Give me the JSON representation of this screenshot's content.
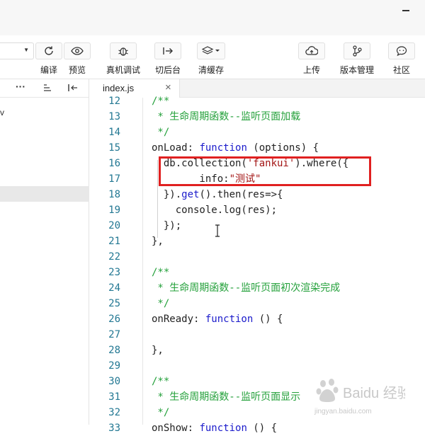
{
  "toolbar": {
    "compile_label": "编译",
    "preview_label": "预览",
    "remote_debug_label": "真机调试",
    "background_label": "切后台",
    "clear_cache_label": "清缓存",
    "upload_label": "上传",
    "version_label": "版本管理",
    "community_label": "社区"
  },
  "sidebar": {
    "tree_partial_text": "v"
  },
  "tabs": [
    {
      "title": "index.js",
      "close": "×"
    }
  ],
  "editor": {
    "lines": [
      {
        "n": "12",
        "tokens": [
          {
            "t": "/**",
            "c": "comment"
          }
        ]
      },
      {
        "n": "13",
        "tokens": [
          {
            "t": " * 生命周期函数--监听页面加载",
            "c": "comment"
          }
        ]
      },
      {
        "n": "14",
        "tokens": [
          {
            "t": " */",
            "c": "comment"
          }
        ]
      },
      {
        "n": "15",
        "tokens": [
          {
            "t": "onLoad: ",
            "c": "txt"
          },
          {
            "t": "function",
            "c": "kw"
          },
          {
            "t": " (options) {",
            "c": "txt"
          }
        ]
      },
      {
        "n": "16",
        "tokens": [
          {
            "t": "  db.collection(",
            "c": "txt"
          },
          {
            "t": "'fankui'",
            "c": "str"
          },
          {
            "t": ").where({",
            "c": "txt"
          }
        ]
      },
      {
        "n": "17",
        "tokens": [
          {
            "t": "        info:",
            "c": "txt"
          },
          {
            "t": "\"测试\"",
            "c": "str"
          }
        ]
      },
      {
        "n": "18",
        "tokens": [
          {
            "t": "  }).",
            "c": "txt"
          },
          {
            "t": "get",
            "c": "kw"
          },
          {
            "t": "().then(res=>{",
            "c": "txt"
          }
        ]
      },
      {
        "n": "19",
        "tokens": [
          {
            "t": "    console.log(res);",
            "c": "txt"
          }
        ]
      },
      {
        "n": "20",
        "tokens": [
          {
            "t": "  });",
            "c": "txt"
          }
        ]
      },
      {
        "n": "21",
        "tokens": [
          {
            "t": "},",
            "c": "txt"
          }
        ]
      },
      {
        "n": "22",
        "tokens": []
      },
      {
        "n": "23",
        "tokens": [
          {
            "t": "/**",
            "c": "comment"
          }
        ]
      },
      {
        "n": "24",
        "tokens": [
          {
            "t": " * 生命周期函数--监听页面初次渲染完成",
            "c": "comment"
          }
        ]
      },
      {
        "n": "25",
        "tokens": [
          {
            "t": " */",
            "c": "comment"
          }
        ]
      },
      {
        "n": "26",
        "tokens": [
          {
            "t": "onReady: ",
            "c": "txt"
          },
          {
            "t": "function",
            "c": "kw"
          },
          {
            "t": " () {",
            "c": "txt"
          }
        ]
      },
      {
        "n": "27",
        "tokens": []
      },
      {
        "n": "28",
        "tokens": [
          {
            "t": "},",
            "c": "txt"
          }
        ]
      },
      {
        "n": "29",
        "tokens": []
      },
      {
        "n": "30",
        "tokens": [
          {
            "t": "/**",
            "c": "comment"
          }
        ]
      },
      {
        "n": "31",
        "tokens": [
          {
            "t": " * 生命周期函数--监听页面显示",
            "c": "comment"
          }
        ]
      },
      {
        "n": "32",
        "tokens": [
          {
            "t": " */",
            "c": "comment"
          }
        ]
      },
      {
        "n": "33",
        "tokens": [
          {
            "t": "onShow: ",
            "c": "txt"
          },
          {
            "t": "function",
            "c": "kw"
          },
          {
            "t": " () {",
            "c": "txt"
          }
        ]
      }
    ]
  },
  "watermark": {
    "brand": "Baidu 经验",
    "url": "jingyan.baidu.com"
  },
  "colors": {
    "comment": "#23a03a",
    "keyword": "#1a1acb",
    "string": "#a31515",
    "line_number": "#237893",
    "highlight_box": "#e02020"
  }
}
